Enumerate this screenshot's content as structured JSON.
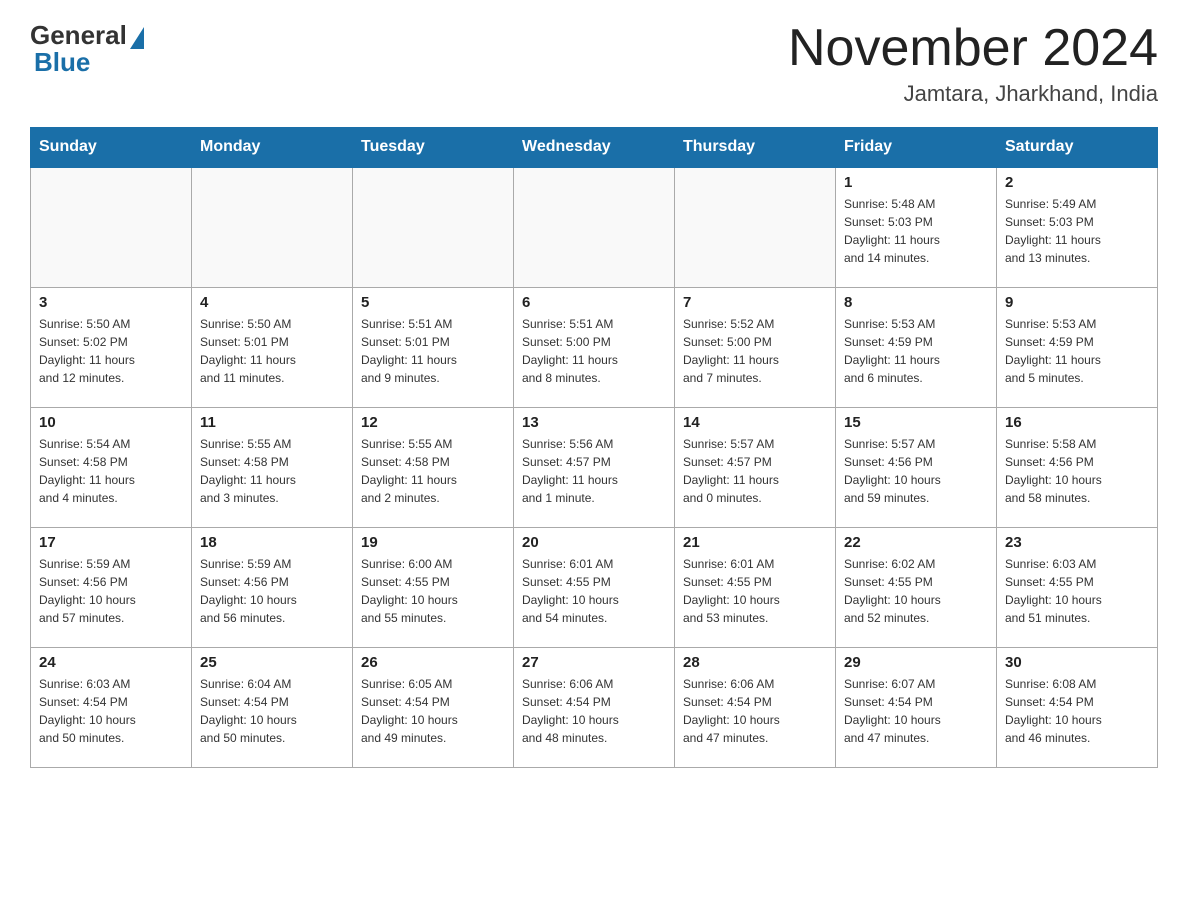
{
  "header": {
    "logo_general": "General",
    "logo_blue": "Blue",
    "month_title": "November 2024",
    "location": "Jamtara, Jharkhand, India"
  },
  "weekdays": [
    "Sunday",
    "Monday",
    "Tuesday",
    "Wednesday",
    "Thursday",
    "Friday",
    "Saturday"
  ],
  "weeks": [
    [
      {
        "day": "",
        "info": ""
      },
      {
        "day": "",
        "info": ""
      },
      {
        "day": "",
        "info": ""
      },
      {
        "day": "",
        "info": ""
      },
      {
        "day": "",
        "info": ""
      },
      {
        "day": "1",
        "info": "Sunrise: 5:48 AM\nSunset: 5:03 PM\nDaylight: 11 hours\nand 14 minutes."
      },
      {
        "day": "2",
        "info": "Sunrise: 5:49 AM\nSunset: 5:03 PM\nDaylight: 11 hours\nand 13 minutes."
      }
    ],
    [
      {
        "day": "3",
        "info": "Sunrise: 5:50 AM\nSunset: 5:02 PM\nDaylight: 11 hours\nand 12 minutes."
      },
      {
        "day": "4",
        "info": "Sunrise: 5:50 AM\nSunset: 5:01 PM\nDaylight: 11 hours\nand 11 minutes."
      },
      {
        "day": "5",
        "info": "Sunrise: 5:51 AM\nSunset: 5:01 PM\nDaylight: 11 hours\nand 9 minutes."
      },
      {
        "day": "6",
        "info": "Sunrise: 5:51 AM\nSunset: 5:00 PM\nDaylight: 11 hours\nand 8 minutes."
      },
      {
        "day": "7",
        "info": "Sunrise: 5:52 AM\nSunset: 5:00 PM\nDaylight: 11 hours\nand 7 minutes."
      },
      {
        "day": "8",
        "info": "Sunrise: 5:53 AM\nSunset: 4:59 PM\nDaylight: 11 hours\nand 6 minutes."
      },
      {
        "day": "9",
        "info": "Sunrise: 5:53 AM\nSunset: 4:59 PM\nDaylight: 11 hours\nand 5 minutes."
      }
    ],
    [
      {
        "day": "10",
        "info": "Sunrise: 5:54 AM\nSunset: 4:58 PM\nDaylight: 11 hours\nand 4 minutes."
      },
      {
        "day": "11",
        "info": "Sunrise: 5:55 AM\nSunset: 4:58 PM\nDaylight: 11 hours\nand 3 minutes."
      },
      {
        "day": "12",
        "info": "Sunrise: 5:55 AM\nSunset: 4:58 PM\nDaylight: 11 hours\nand 2 minutes."
      },
      {
        "day": "13",
        "info": "Sunrise: 5:56 AM\nSunset: 4:57 PM\nDaylight: 11 hours\nand 1 minute."
      },
      {
        "day": "14",
        "info": "Sunrise: 5:57 AM\nSunset: 4:57 PM\nDaylight: 11 hours\nand 0 minutes."
      },
      {
        "day": "15",
        "info": "Sunrise: 5:57 AM\nSunset: 4:56 PM\nDaylight: 10 hours\nand 59 minutes."
      },
      {
        "day": "16",
        "info": "Sunrise: 5:58 AM\nSunset: 4:56 PM\nDaylight: 10 hours\nand 58 minutes."
      }
    ],
    [
      {
        "day": "17",
        "info": "Sunrise: 5:59 AM\nSunset: 4:56 PM\nDaylight: 10 hours\nand 57 minutes."
      },
      {
        "day": "18",
        "info": "Sunrise: 5:59 AM\nSunset: 4:56 PM\nDaylight: 10 hours\nand 56 minutes."
      },
      {
        "day": "19",
        "info": "Sunrise: 6:00 AM\nSunset: 4:55 PM\nDaylight: 10 hours\nand 55 minutes."
      },
      {
        "day": "20",
        "info": "Sunrise: 6:01 AM\nSunset: 4:55 PM\nDaylight: 10 hours\nand 54 minutes."
      },
      {
        "day": "21",
        "info": "Sunrise: 6:01 AM\nSunset: 4:55 PM\nDaylight: 10 hours\nand 53 minutes."
      },
      {
        "day": "22",
        "info": "Sunrise: 6:02 AM\nSunset: 4:55 PM\nDaylight: 10 hours\nand 52 minutes."
      },
      {
        "day": "23",
        "info": "Sunrise: 6:03 AM\nSunset: 4:55 PM\nDaylight: 10 hours\nand 51 minutes."
      }
    ],
    [
      {
        "day": "24",
        "info": "Sunrise: 6:03 AM\nSunset: 4:54 PM\nDaylight: 10 hours\nand 50 minutes."
      },
      {
        "day": "25",
        "info": "Sunrise: 6:04 AM\nSunset: 4:54 PM\nDaylight: 10 hours\nand 50 minutes."
      },
      {
        "day": "26",
        "info": "Sunrise: 6:05 AM\nSunset: 4:54 PM\nDaylight: 10 hours\nand 49 minutes."
      },
      {
        "day": "27",
        "info": "Sunrise: 6:06 AM\nSunset: 4:54 PM\nDaylight: 10 hours\nand 48 minutes."
      },
      {
        "day": "28",
        "info": "Sunrise: 6:06 AM\nSunset: 4:54 PM\nDaylight: 10 hours\nand 47 minutes."
      },
      {
        "day": "29",
        "info": "Sunrise: 6:07 AM\nSunset: 4:54 PM\nDaylight: 10 hours\nand 47 minutes."
      },
      {
        "day": "30",
        "info": "Sunrise: 6:08 AM\nSunset: 4:54 PM\nDaylight: 10 hours\nand 46 minutes."
      }
    ]
  ]
}
